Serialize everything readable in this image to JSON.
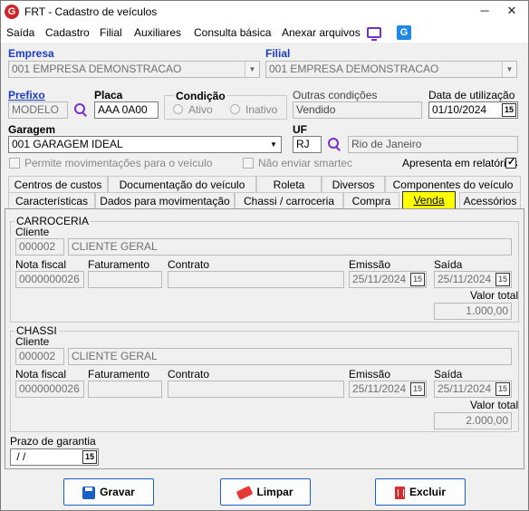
{
  "window": {
    "title": "FRT - Cadastro de veículos",
    "logo_letter": "G"
  },
  "menu": [
    "Saída",
    "Cadastro",
    "Filial",
    "Auxiliares",
    "Consulta básica",
    "Anexar arquivos"
  ],
  "menu_icons": {
    "monitor": "monitor-icon",
    "g": "G"
  },
  "labels": {
    "empresa": "Empresa",
    "filial": "Filial",
    "prefixo": "Prefixo",
    "placa": "Placa",
    "condicao": "Condição",
    "ativo": "Ativo",
    "inativo": "Inativo",
    "outras_condicoes": "Outras condições",
    "data_utilizacao": "Data de utilização",
    "garagem": "Garagem",
    "uf": "UF",
    "permite_mov": "Permite movimentações para o veículo",
    "nao_enviar": "Não enviar smartec",
    "apresenta": "Apresenta em relatórios"
  },
  "fields": {
    "empresa": "001 EMPRESA DEMONSTRACAO",
    "filial": "001 EMPRESA DEMONSTRACAO",
    "prefixo": "MODELO",
    "placa": "AAA 0A00",
    "outras_condicoes": "Vendido",
    "data_utilizacao": "01/10/2024",
    "garagem": "001 GARAGEM IDEAL",
    "uf": "RJ",
    "uf_nome": "Rio de Janeiro"
  },
  "checks": {
    "apresenta": true
  },
  "tabs_row1": [
    "Centros de custos",
    "Documentação do veículo",
    "Roleta",
    "Diversos",
    "Componentes do veículo"
  ],
  "tabs_row2": [
    "Características",
    "Dados para movimentação",
    "Chassi / carroceria",
    "Compra",
    "Venda",
    "Acessórios"
  ],
  "active_tab": "Venda",
  "venda": {
    "carroceria": {
      "title": "CARROCERIA",
      "cliente_label": "Cliente",
      "cliente_codigo": "000002",
      "cliente_nome": "CLIENTE GERAL",
      "nota_label": "Nota fiscal",
      "nota": "0000000026",
      "faturamento_label": "Faturamento",
      "faturamento": "",
      "contrato_label": "Contrato",
      "contrato": "",
      "emissao_label": "Emissão",
      "emissao": "25/11/2024",
      "saida_label": "Saída",
      "saida": "25/11/2024",
      "valor_label": "Valor total",
      "valor": "1.000,00"
    },
    "chassi": {
      "title": "CHASSI",
      "cliente_label": "Cliente",
      "cliente_codigo": "000002",
      "cliente_nome": "CLIENTE GERAL",
      "nota_label": "Nota fiscal",
      "nota": "0000000026",
      "faturamento_label": "Faturamento",
      "faturamento": "",
      "contrato_label": "Contrato",
      "contrato": "",
      "emissao_label": "Emissão",
      "emissao": "25/11/2024",
      "saida_label": "Saída",
      "saida": "25/11/2024",
      "valor_label": "Valor total",
      "valor": "2.000,00"
    },
    "prazo_label": "Prazo de garantia",
    "prazo": " / /"
  },
  "buttons": {
    "gravar": "Gravar",
    "limpar": "Limpar",
    "excluir": "Excluir"
  },
  "cal_glyph": "15",
  "colors": {
    "accent": "#1a3cc8",
    "active_tab": "#ffff00",
    "brand": "#d1232a"
  }
}
